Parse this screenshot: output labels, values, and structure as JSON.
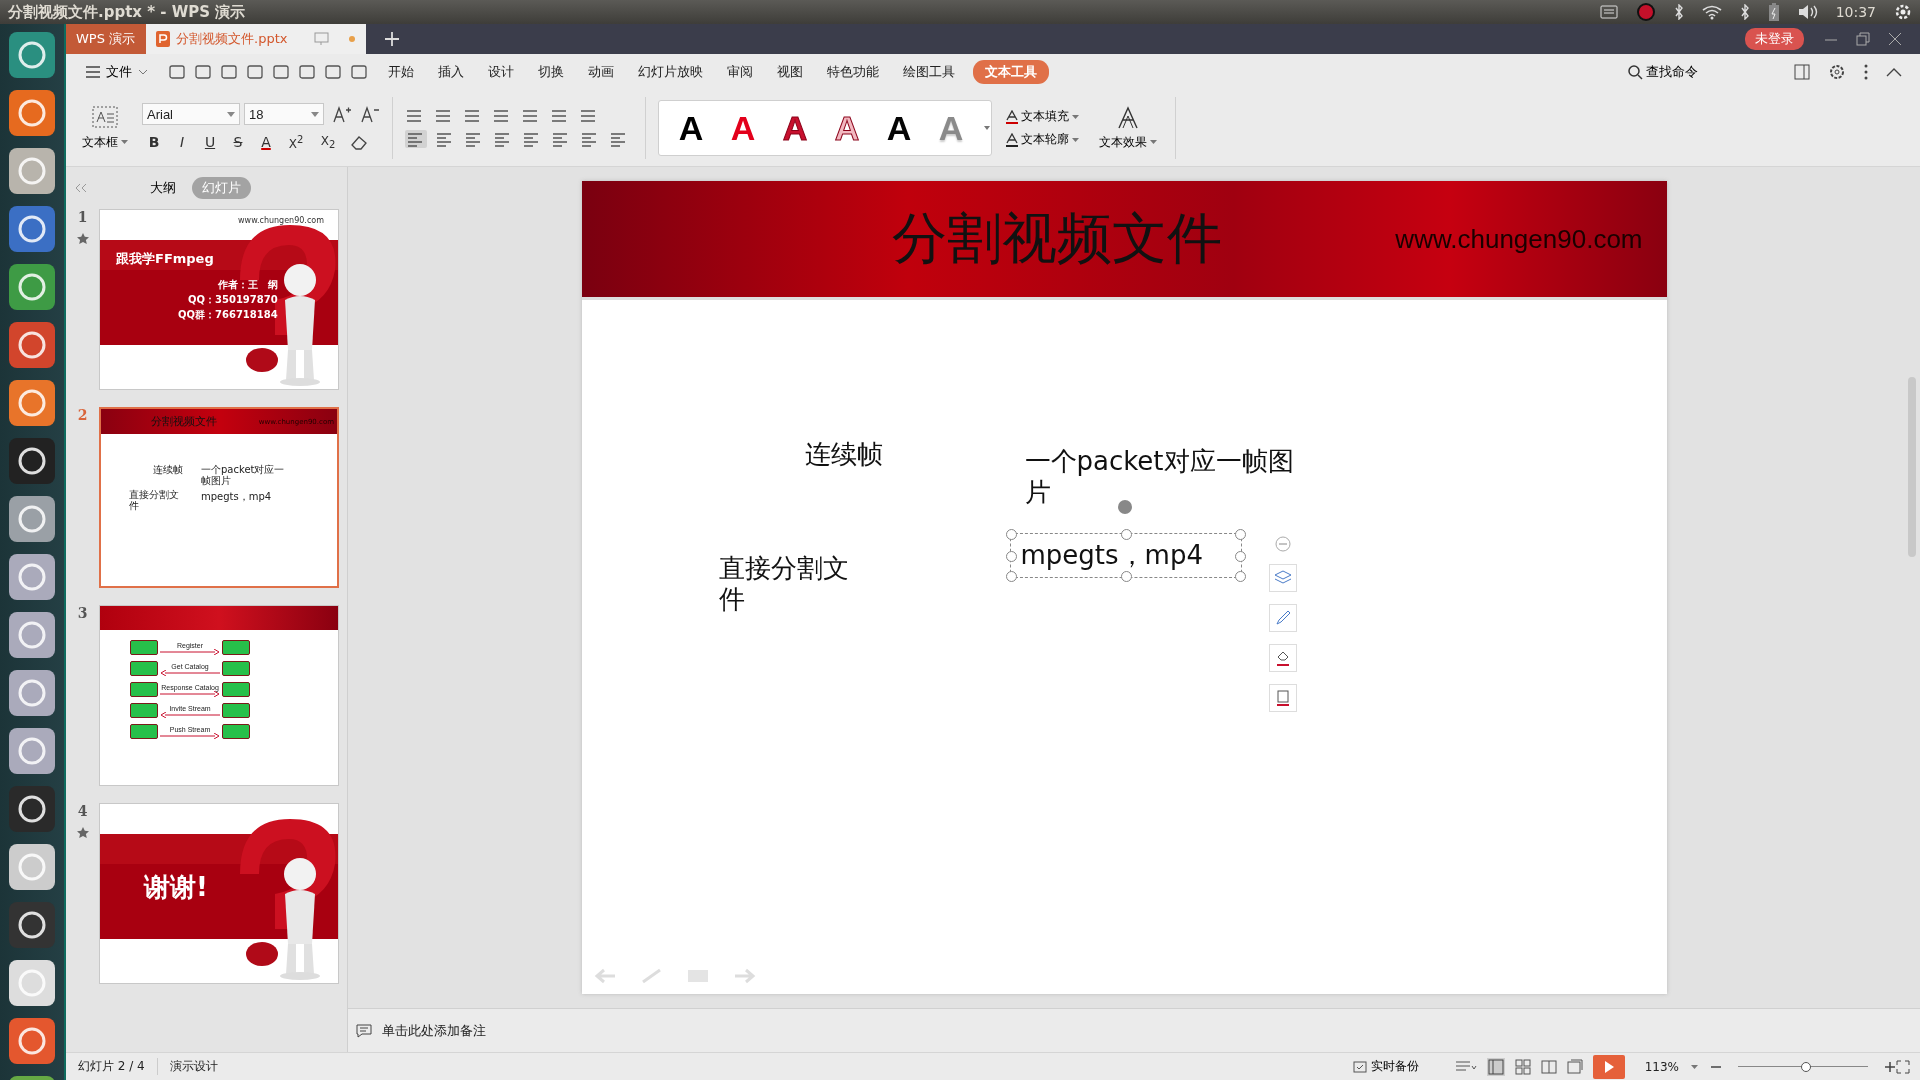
{
  "os_bar": {
    "title": "分割视频文件.pptx * - WPS 演示",
    "clock": "10:37"
  },
  "tabs": [
    {
      "label": "WPS 演示",
      "kind": "app",
      "selected": false
    },
    {
      "label": "分割视频文件.pptx",
      "kind": "doc",
      "selected": true
    }
  ],
  "login_badge": "未登录",
  "menu": {
    "file": "文件",
    "items": [
      {
        "label": "开始",
        "selected": false
      },
      {
        "label": "插入",
        "selected": false
      },
      {
        "label": "设计",
        "selected": false
      },
      {
        "label": "切换",
        "selected": false
      },
      {
        "label": "动画",
        "selected": false
      },
      {
        "label": "幻灯片放映",
        "selected": false
      },
      {
        "label": "审阅",
        "selected": false
      },
      {
        "label": "视图",
        "selected": false
      },
      {
        "label": "特色功能",
        "selected": false
      },
      {
        "label": "绘图工具",
        "selected": false
      },
      {
        "label": "文本工具",
        "selected": true
      }
    ],
    "search": "查找命令"
  },
  "ribbon": {
    "textbox": "文本框",
    "font": "Arial",
    "size": "18",
    "format": [
      "B",
      "I",
      "U",
      "S",
      "A",
      "X$^{2}$",
      "X$_{2}$"
    ],
    "text_styles": [
      {
        "label": "A",
        "kind": "solid",
        "color": "#000000"
      },
      {
        "label": "A",
        "kind": "solid",
        "color": "#e3001b"
      },
      {
        "label": "A",
        "kind": "outline",
        "color": "#c8102e"
      },
      {
        "label": "A",
        "kind": "outline",
        "color": "#f2b8c0"
      },
      {
        "label": "A",
        "kind": "solid",
        "color": "#050505"
      },
      {
        "label": "A",
        "kind": "gradient",
        "color": "#8a8a8a"
      }
    ],
    "fill": "文本填充",
    "outline": "文本轮廓",
    "effect": "文本效果"
  },
  "panel": {
    "tabs": [
      {
        "label": "大纲",
        "selected": false
      },
      {
        "label": "幻灯片",
        "selected": true
      }
    ],
    "slides": [
      {
        "number": "1",
        "kind": "title",
        "starred": true,
        "selected": false,
        "url": "www.chungen90.com",
        "heading": "跟我学FFmpeg",
        "lines": [
          "作者：王　纲",
          "QQ：350197870",
          "QQ群：766718184"
        ]
      },
      {
        "number": "2",
        "kind": "content",
        "starred": false,
        "selected": true,
        "title": "分割视频文件",
        "url": "www.chungen90.com",
        "items": [
          "连续帧",
          "一个packet对应一帧图片",
          "直接分割文件",
          "mpegts，mp4"
        ]
      },
      {
        "number": "3",
        "kind": "diagram",
        "starred": false,
        "selected": false,
        "rows": [
          {
            "label": "Register",
            "reverse": false
          },
          {
            "label": "Get Catalog",
            "reverse": true
          },
          {
            "label": "Response Catalog",
            "reverse": false
          },
          {
            "label": "Invite Stream",
            "reverse": true
          },
          {
            "label": "Push Stream",
            "reverse": false
          }
        ]
      },
      {
        "number": "4",
        "kind": "end",
        "starred": true,
        "selected": false,
        "heading": "谢谢!"
      }
    ]
  },
  "slide": {
    "title": "分割视频文件",
    "url": "www.chungen90.com",
    "items": [
      {
        "text": "连续帧",
        "selected": false
      },
      {
        "text": "一个packet对应一帧图片",
        "selected": false
      },
      {
        "text": "直接分割文件",
        "selected": false
      },
      {
        "text": "mpegts，mp4",
        "selected": true
      }
    ]
  },
  "notes": "单击此处添加备注",
  "status": {
    "slide": "幻灯片 2 / 4",
    "theme": "演示设计",
    "backup": "实时备份",
    "zoom": "113%",
    "zoom_slider": {
      "level": 0.52
    }
  }
}
